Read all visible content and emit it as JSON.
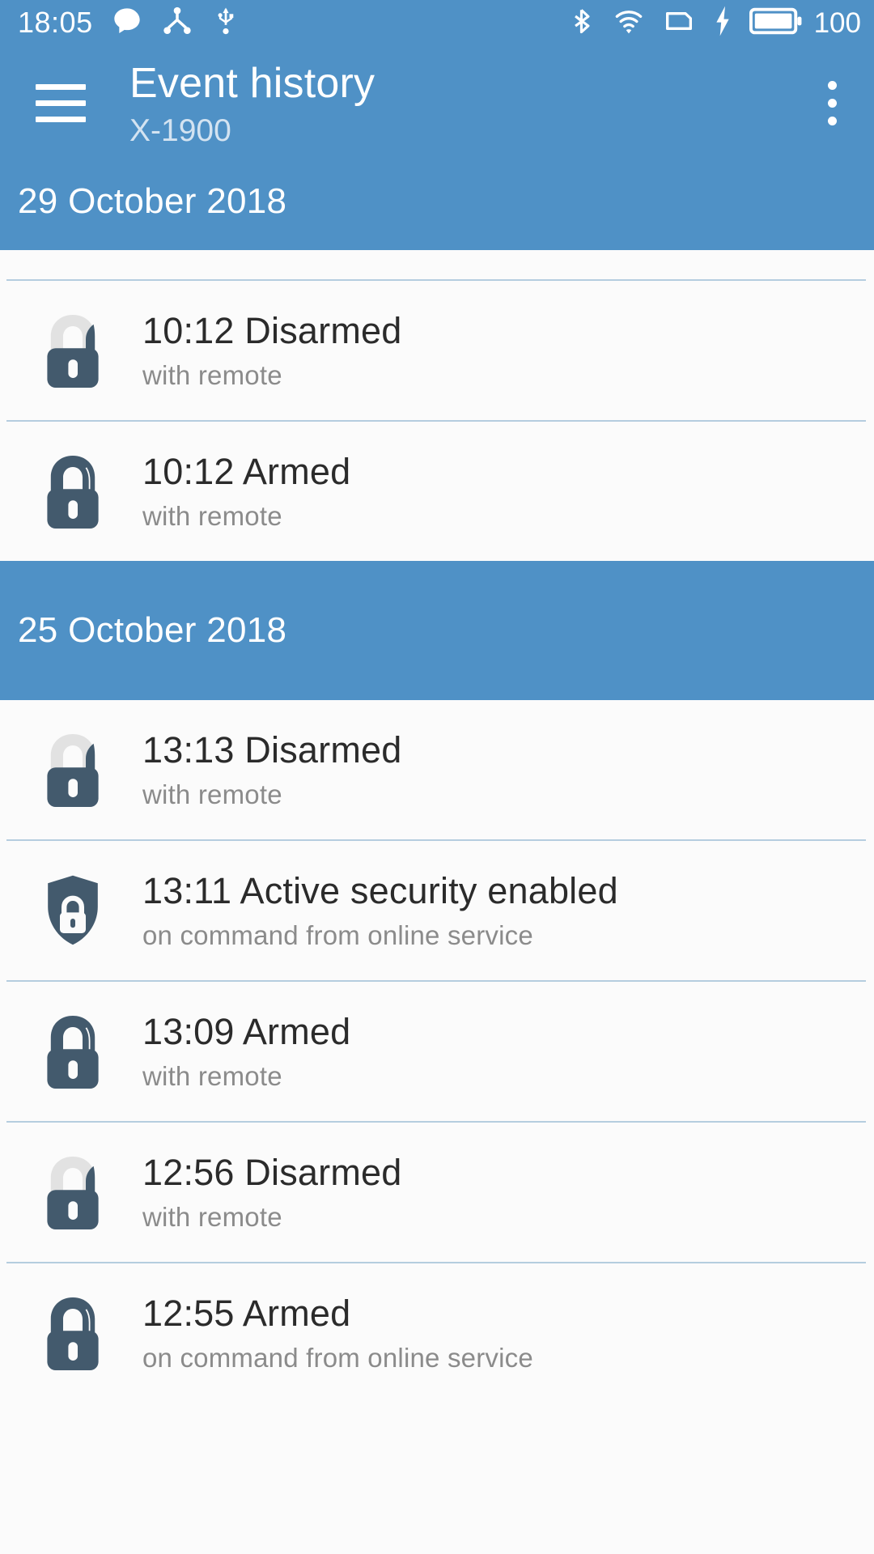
{
  "statusbar": {
    "time": "18:05",
    "battery_text": "100",
    "left_icons": [
      "chat-bubble-icon",
      "share-nodes-icon",
      "usb-icon"
    ],
    "right_icons": [
      "bluetooth-icon",
      "wifi-icon",
      "sim-card-icon",
      "charging-bolt-icon",
      "battery-icon"
    ]
  },
  "appbar": {
    "menu_icon": "hamburger-menu-icon",
    "title": "Event history",
    "subtitle": "X-1900",
    "overflow_icon": "overflow-menu-icon"
  },
  "colors": {
    "primary_blue": "#4f91c6",
    "divider": "#9dbdd6",
    "icon_dark": "#435a6d",
    "icon_light": "#e2e2e2",
    "title_text": "#2b2b2b",
    "sub_text": "#8b8b8b",
    "list_bg": "#fbfbfb"
  },
  "sections": [
    {
      "date": "29 October 2018",
      "events": [
        {
          "time": "10:12",
          "title": "10:12 Disarmed",
          "subtitle": "with remote",
          "icon": "padlock-open-icon"
        },
        {
          "time": "10:12",
          "title": "10:12 Armed",
          "subtitle": "with remote",
          "icon": "padlock-closed-icon"
        }
      ]
    },
    {
      "date": "25 October 2018",
      "events": [
        {
          "time": "13:13",
          "title": "13:13 Disarmed",
          "subtitle": "with remote",
          "icon": "padlock-open-icon"
        },
        {
          "time": "13:11",
          "title": "13:11 Active security enabled",
          "subtitle": "on command from online service",
          "icon": "shield-lock-icon"
        },
        {
          "time": "13:09",
          "title": "13:09 Armed",
          "subtitle": "with remote",
          "icon": "padlock-closed-icon"
        },
        {
          "time": "12:56",
          "title": "12:56 Disarmed",
          "subtitle": "with remote",
          "icon": "padlock-open-icon"
        },
        {
          "time": "12:55",
          "title": "12:55 Armed",
          "subtitle": "on command from online service",
          "icon": "padlock-closed-icon"
        }
      ]
    }
  ]
}
